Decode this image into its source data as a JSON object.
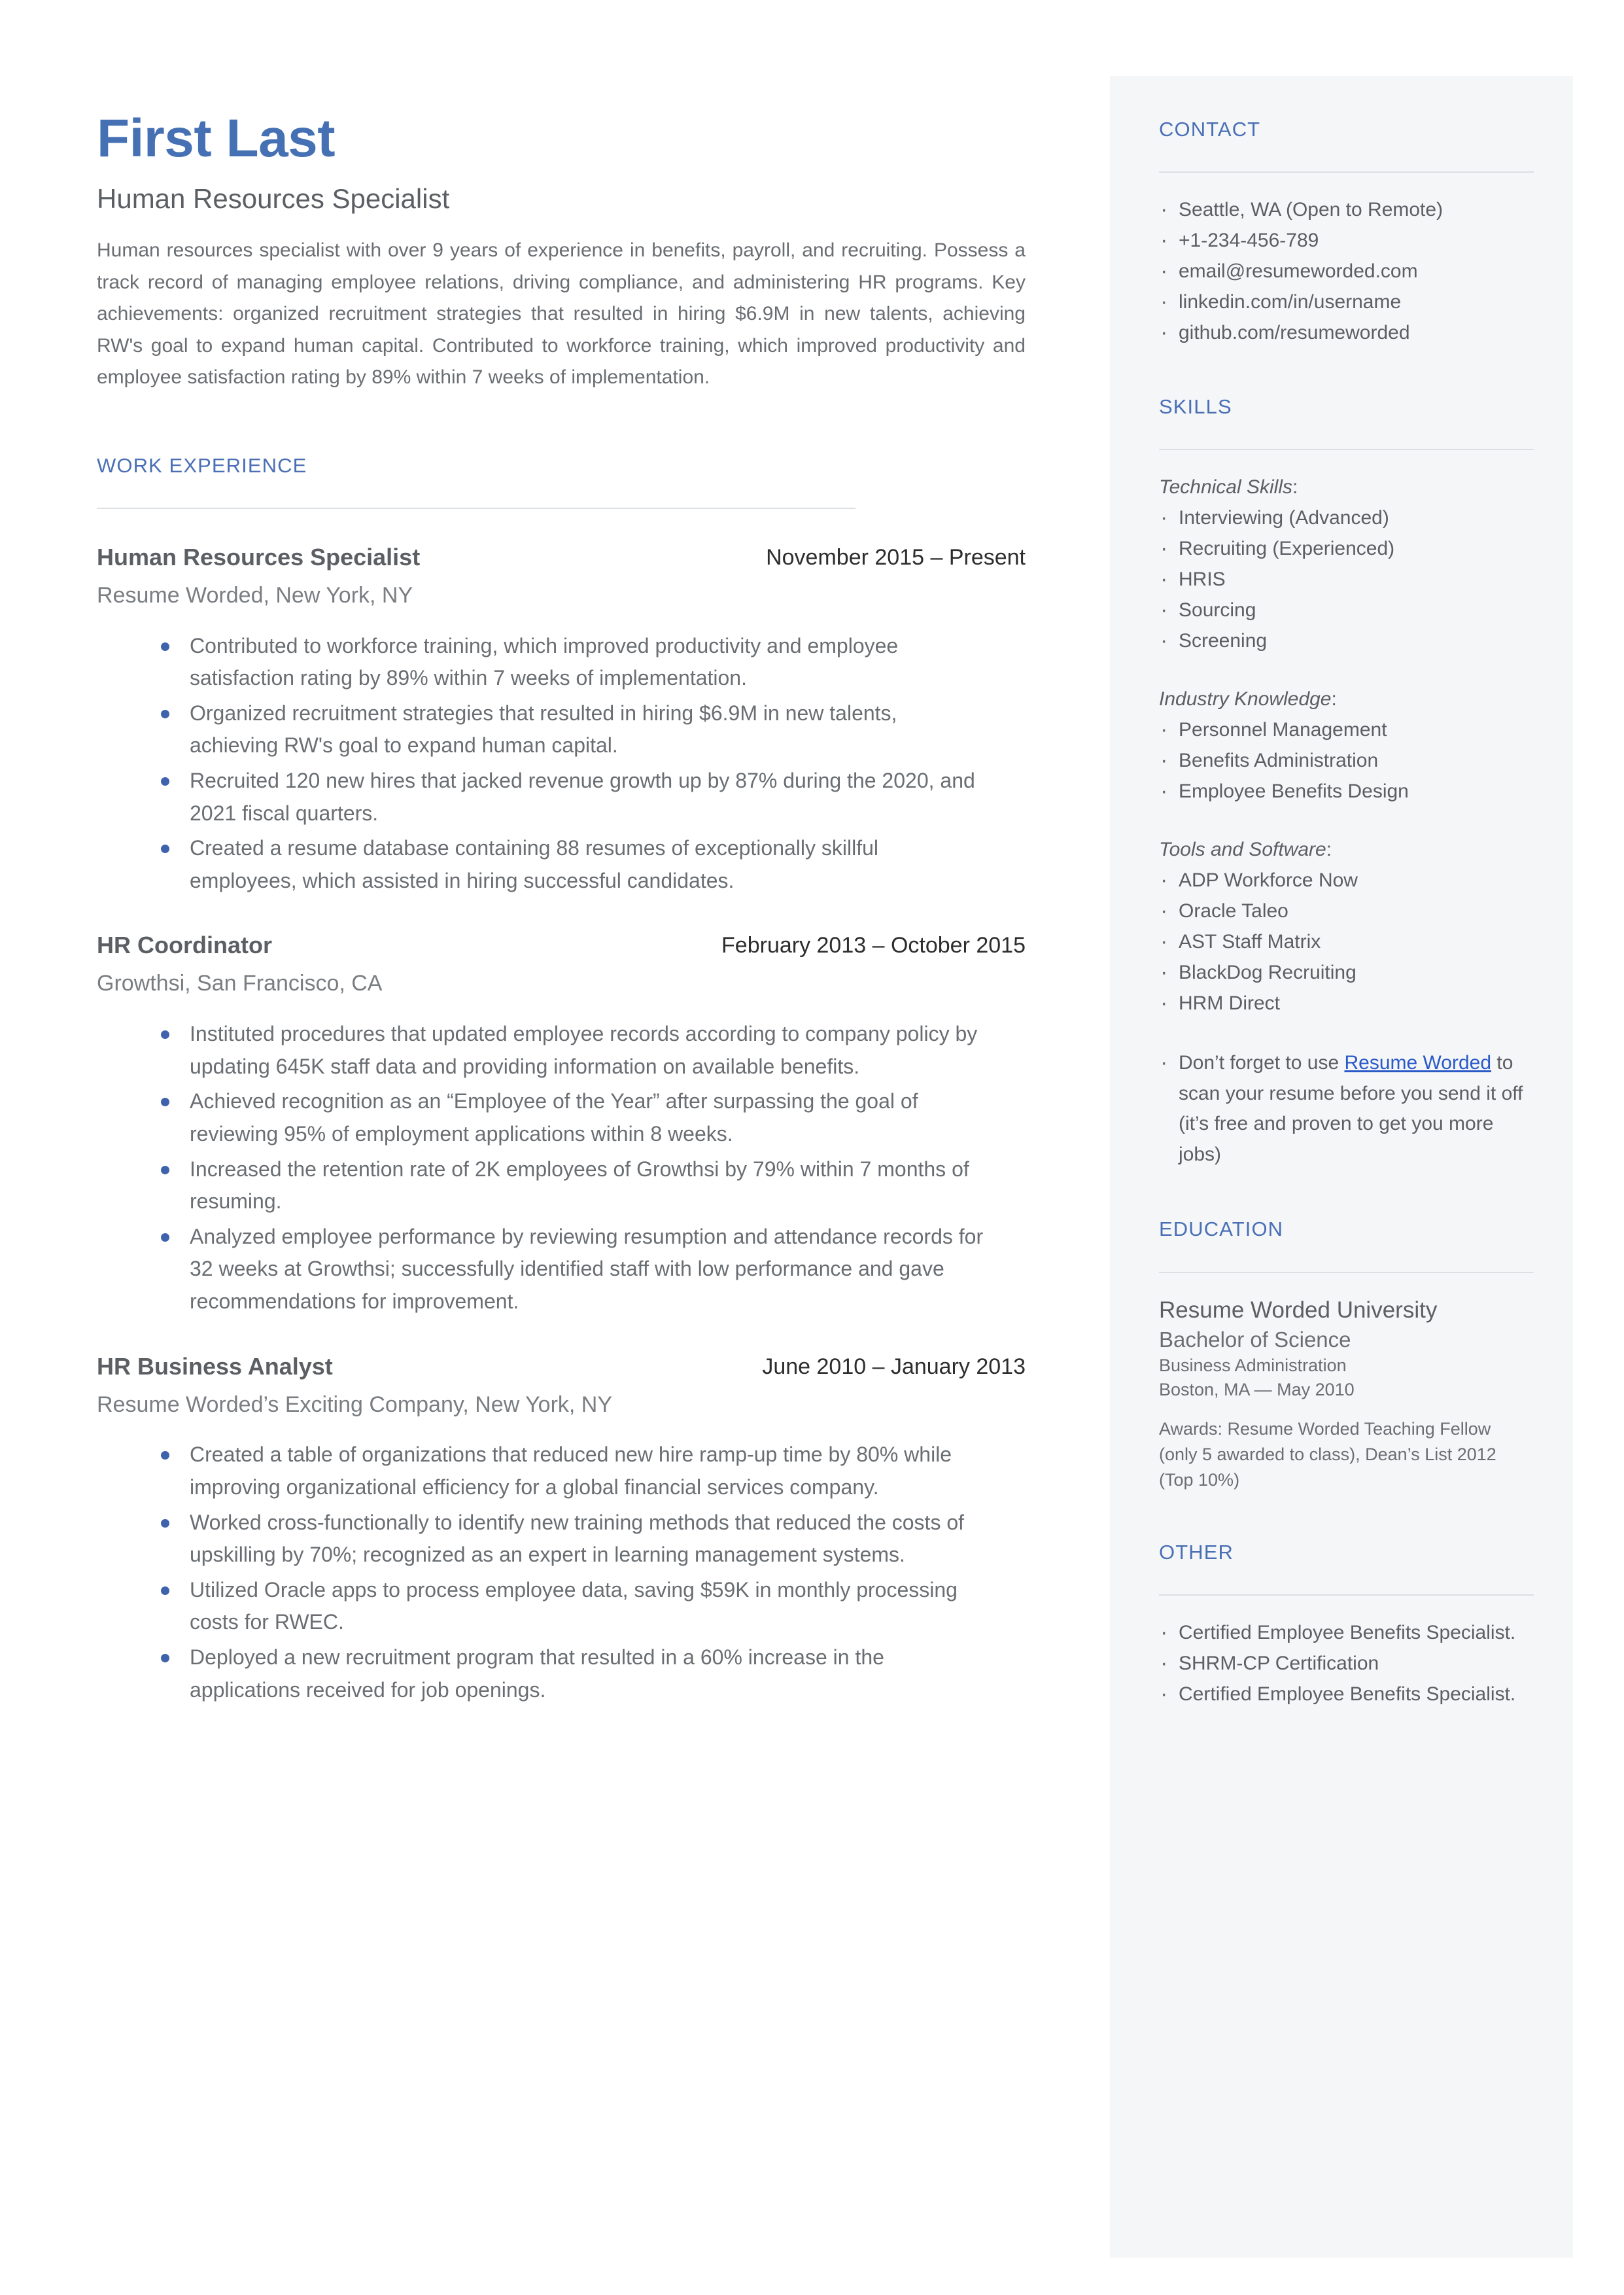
{
  "header": {
    "name": "First Last",
    "role": "Human Resources Specialist",
    "summary": "Human resources specialist with over 9 years of experience in benefits, payroll, and recruiting. Possess a track record of managing employee relations, driving compliance, and administering HR programs. Key achievements: organized recruitment strategies that resulted in hiring $6.9M in new talents, achieving RW's goal to expand human capital. Contributed to workforce training, which improved productivity and employee satisfaction rating by 89% within 7 weeks of implementation."
  },
  "work": {
    "heading": "WORK EXPERIENCE",
    "jobs": [
      {
        "title": "Human Resources Specialist",
        "date": "November 2015 – Present",
        "company": "Resume Worded, New York, NY",
        "bullets": [
          "Contributed to workforce training, which improved productivity and employee satisfaction rating by 89% within 7 weeks of implementation.",
          "Organized recruitment strategies that resulted in hiring $6.9M in new talents, achieving RW's goal to expand human capital.",
          "Recruited 120 new hires that jacked revenue growth up by 87% during the 2020, and 2021 fiscal quarters.",
          "Created a resume database containing 88 resumes of exceptionally skillful employees, which assisted in hiring successful candidates."
        ]
      },
      {
        "title": "HR Coordinator",
        "date": "February 2013 – October 2015",
        "company": "Growthsi, San Francisco, CA",
        "bullets": [
          "Instituted procedures that updated employee records according to company policy by updating 645K staff data and providing information on available benefits.",
          "Achieved recognition as an “Employee of the Year” after surpassing the goal of reviewing 95% of employment applications within 8 weeks.",
          "Increased the retention rate of 2K employees of Growthsi by 79% within 7 months of resuming.",
          "Analyzed employee performance by reviewing resumption and attendance records for 32 weeks at Growthsi; successfully identified staff with low performance and gave recommendations for improvement."
        ]
      },
      {
        "title": "HR Business Analyst",
        "date": "June 2010 – January 2013",
        "company": "Resume Worded’s Exciting Company, New York, NY",
        "bullets": [
          "Created a table of organizations that reduced new hire ramp-up time by 80% while improving organizational efficiency for a global financial services company.",
          "Worked cross-functionally to identify new training methods that reduced the costs of upskilling by 70%; recognized as an expert in learning management systems.",
          "Utilized Oracle apps to process employee data, saving $59K in monthly processing costs for RWEC.",
          "Deployed a new recruitment program that resulted in a 60% increase in the applications received for job openings."
        ]
      }
    ]
  },
  "contact": {
    "heading": "CONTACT",
    "items": [
      "Seattle, WA (Open to Remote)",
      "+1-234-456-789",
      "email@resumeworded.com",
      "linkedin.com/in/username",
      "github.com/resumeworded"
    ]
  },
  "skills": {
    "heading": "SKILLS",
    "groups": [
      {
        "label": "Technical Skills",
        "items": [
          "Interviewing (Advanced)",
          "Recruiting (Experienced)",
          "HRIS",
          "Sourcing",
          "Screening"
        ]
      },
      {
        "label": "Industry Knowledge",
        "items": [
          "Personnel Management",
          "Benefits Administration",
          "Employee Benefits Design"
        ]
      },
      {
        "label": "Tools and Software",
        "items": [
          "ADP Workforce Now",
          "Oracle Taleo",
          "AST Staff Matrix",
          "BlackDog Recruiting",
          "HRM Direct"
        ]
      }
    ],
    "promo": {
      "before": "Don’t forget to use ",
      "link": "Resume Worded",
      "after": " to scan your resume before you send it off (it’s free and proven to get you more jobs)"
    }
  },
  "education": {
    "heading": "EDUCATION",
    "school": "Resume Worded University",
    "degree": "Bachelor of Science",
    "major": "Business Administration",
    "location": "Boston, MA — May 2010",
    "awards": "Awards: Resume Worded Teaching Fellow (only 5 awarded to class), Dean’s List 2012 (Top 10%)"
  },
  "other": {
    "heading": "OTHER",
    "items": [
      "Certified Employee Benefits Specialist.",
      "SHRM-CP Certification",
      "Certified Employee Benefits Specialist."
    ]
  },
  "colors": {
    "accent_name": "#4571b4",
    "accent_heading": "#4a6fb5",
    "bullet": "#3f62ad",
    "link": "#2a59c8",
    "sidebar_bg": "#f4f6f8",
    "body_text": "#6a6e72"
  }
}
